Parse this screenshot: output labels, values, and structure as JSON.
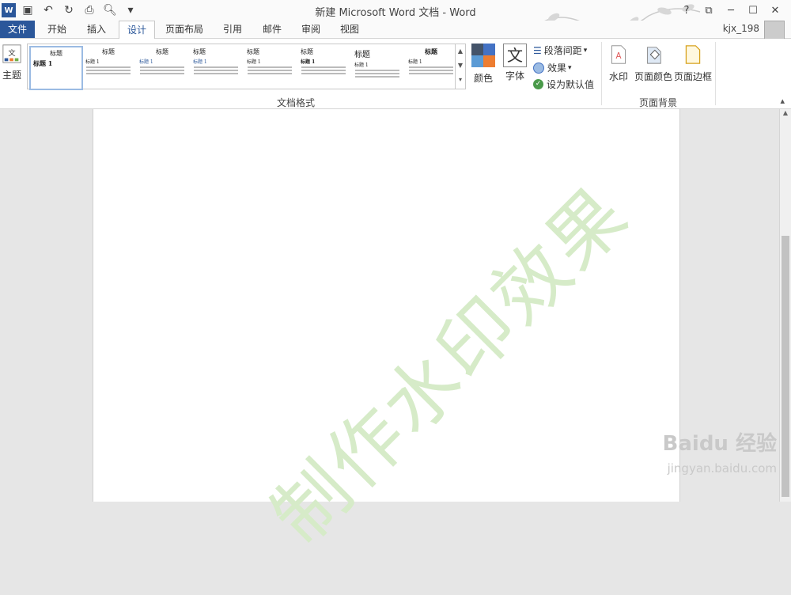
{
  "window": {
    "title": "新建 Microsoft Word 文档 - Word",
    "user": "kjx_198",
    "help": "?",
    "restore_ribbon": "⧉",
    "minimize": "─",
    "maximize": "☐",
    "close": "✕"
  },
  "tabs": [
    "文件",
    "开始",
    "插入",
    "设计",
    "页面布局",
    "引用",
    "邮件",
    "审阅",
    "视图"
  ],
  "active_tab": "设计",
  "ribbon": {
    "theme_label": "主题",
    "gallery_group_label": "文档格式",
    "thumbs": [
      {
        "title": "标题",
        "subtitle": "标题 1"
      },
      {
        "title": "标题",
        "subtitle": "标题 1"
      },
      {
        "title": "标题",
        "subtitle": "标题 1"
      },
      {
        "title": "标题",
        "subtitle": "标题 1"
      },
      {
        "title": "标题",
        "subtitle": "标题 1"
      },
      {
        "title": "标题",
        "subtitle": "标题 1"
      },
      {
        "title": "标题",
        "subtitle": "标题 1"
      },
      {
        "title": "标题",
        "subtitle": "标题 1"
      }
    ],
    "colors_label": "颜色",
    "fonts_label": "字体",
    "paragraph_spacing": "段落间距",
    "effects": "效果",
    "set_default": "设为默认值",
    "watermark_label": "水印",
    "page_color_label": "页面颜色",
    "page_border_label": "页面边框",
    "page_bg_group": "页面背景"
  },
  "document": {
    "watermark_text": "制作水印效果"
  },
  "branding": {
    "baidu_logo": "Baidu 经验",
    "baidu_url": "jingyan.baidu.com"
  },
  "colors": {
    "word_blue": "#2b579a",
    "watermark": "#d6ebc8"
  }
}
